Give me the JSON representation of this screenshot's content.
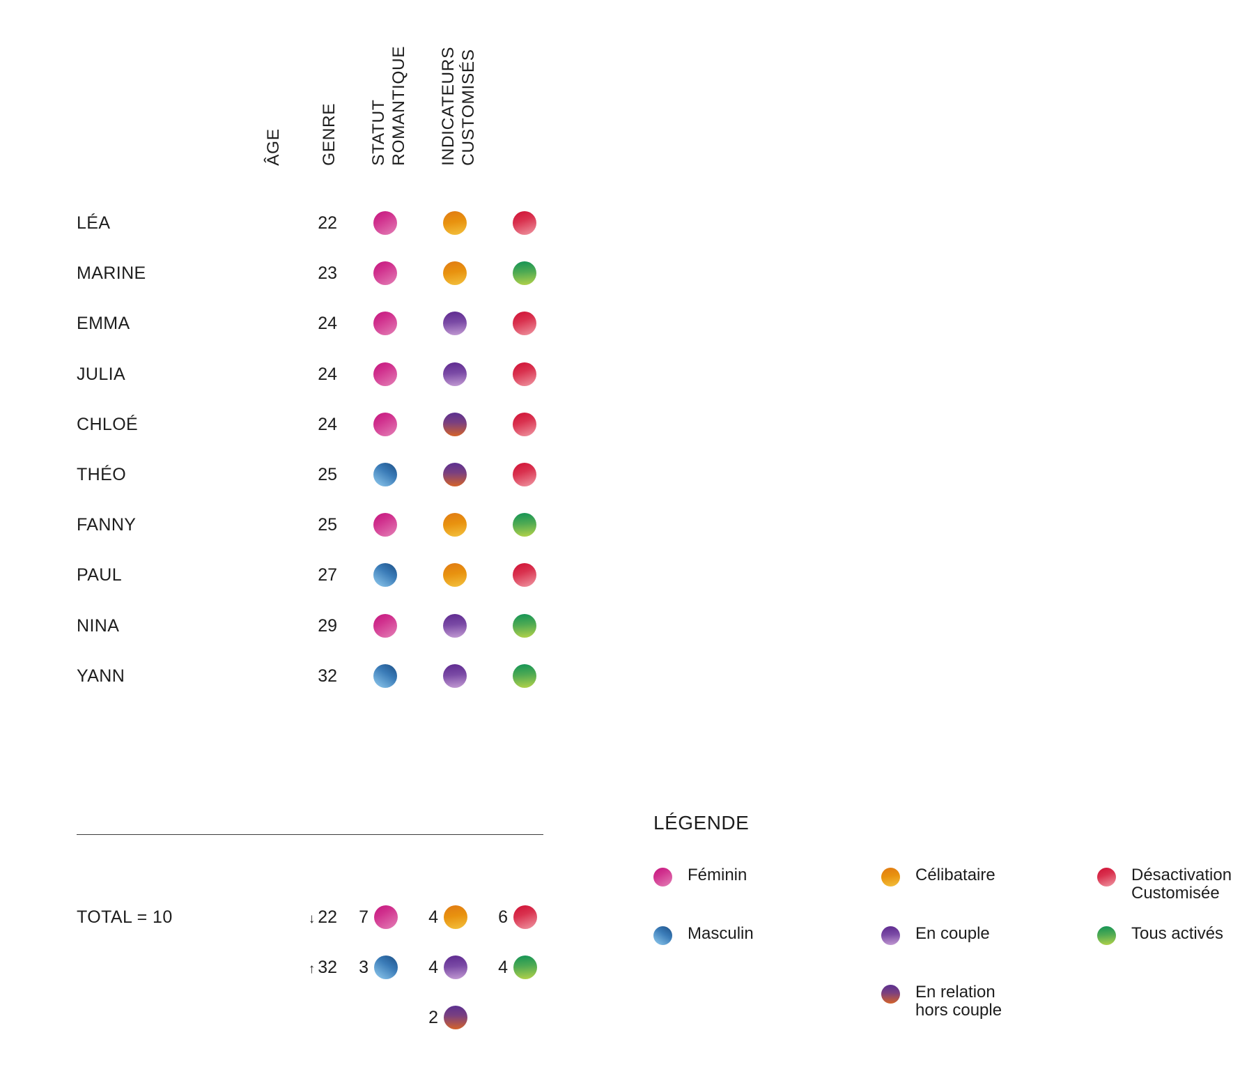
{
  "columns": [
    {
      "id": "age",
      "lines": [
        "ÂGE"
      ]
    },
    {
      "id": "genre",
      "lines": [
        "GENRE"
      ]
    },
    {
      "id": "statut",
      "lines": [
        "STATUT",
        "ROMANTIQUE"
      ]
    },
    {
      "id": "indic",
      "lines": [
        "INDICATEURS",
        "CUSTOMISÉS"
      ]
    }
  ],
  "rows": [
    {
      "name": "LÉA",
      "age": "22",
      "genre": "feminin",
      "statut": "celibataire",
      "indicateurs": "desactivation"
    },
    {
      "name": "MARINE",
      "age": "23",
      "genre": "feminin",
      "statut": "celibataire",
      "indicateurs": "tous-actives"
    },
    {
      "name": "EMMA",
      "age": "24",
      "genre": "feminin",
      "statut": "en-couple",
      "indicateurs": "desactivation"
    },
    {
      "name": "JULIA",
      "age": "24",
      "genre": "feminin",
      "statut": "en-couple",
      "indicateurs": "desactivation"
    },
    {
      "name": "CHLOÉ",
      "age": "24",
      "genre": "feminin",
      "statut": "en-relation",
      "indicateurs": "desactivation"
    },
    {
      "name": "THÉO",
      "age": "25",
      "genre": "masculin",
      "statut": "en-relation",
      "indicateurs": "desactivation"
    },
    {
      "name": "FANNY",
      "age": "25",
      "genre": "feminin",
      "statut": "celibataire",
      "indicateurs": "tous-actives"
    },
    {
      "name": "PAUL",
      "age": "27",
      "genre": "masculin",
      "statut": "celibataire",
      "indicateurs": "desactivation"
    },
    {
      "name": "NINA",
      "age": "29",
      "genre": "feminin",
      "statut": "en-couple",
      "indicateurs": "tous-actives"
    },
    {
      "name": "YANN",
      "age": "32",
      "genre": "masculin",
      "statut": "en-couple",
      "indicateurs": "tous-actives"
    }
  ],
  "totals": {
    "label": "TOTAL = 10",
    "age_min": {
      "arrow": "↓",
      "value": "22"
    },
    "age_max": {
      "arrow": "↑",
      "value": "32"
    },
    "genre": [
      {
        "count": "7",
        "swatch": "feminin"
      },
      {
        "count": "3",
        "swatch": "masculin"
      }
    ],
    "statut": [
      {
        "count": "4",
        "swatch": "celibataire"
      },
      {
        "count": "4",
        "swatch": "en-couple"
      },
      {
        "count": "2",
        "swatch": "en-relation"
      }
    ],
    "indicateurs": [
      {
        "count": "6",
        "swatch": "desactivation"
      },
      {
        "count": "4",
        "swatch": "tous-actives"
      }
    ]
  },
  "legend": {
    "title": "LÉGENDE",
    "items": [
      {
        "swatch": "feminin",
        "label": "Féminin",
        "col": 1,
        "row": 1
      },
      {
        "swatch": "masculin",
        "label": "Masculin",
        "col": 1,
        "row": 2
      },
      {
        "swatch": "celibataire",
        "label": "Célibataire",
        "col": 2,
        "row": 1
      },
      {
        "swatch": "en-couple",
        "label": "En couple",
        "col": 2,
        "row": 2
      },
      {
        "swatch": "en-relation",
        "label": "En relation\nhors couple",
        "col": 2,
        "row": 3
      },
      {
        "swatch": "desactivation",
        "label": "Désactivation\nCustomisée",
        "col": 3,
        "row": 1
      },
      {
        "swatch": "tous-actives",
        "label": "Tous activés",
        "col": 3,
        "row": 2
      }
    ]
  },
  "swatch_colors": {
    "feminin": {
      "from": "#c4157e",
      "to": "#e481b7"
    },
    "masculin": {
      "from": "#1c4f86",
      "to": "#93cdf0"
    },
    "celibataire": {
      "from": "#e07a14",
      "to": "#f3c23f"
    },
    "en-couple": {
      "from": "#5e2a8f",
      "to": "#c49cd4"
    },
    "en-relation": {
      "from": "#5c3090",
      "to": "#d4632a"
    },
    "desactivation": {
      "from": "#cf0f33",
      "to": "#f09aa5"
    },
    "tous-actives": {
      "from": "#139356",
      "to": "#b5d34a"
    }
  },
  "chart_data": {
    "type": "table",
    "title": "",
    "categories": [
      "LÉA",
      "MARINE",
      "EMMA",
      "JULIA",
      "CHLOÉ",
      "THÉO",
      "FANNY",
      "PAUL",
      "NINA",
      "YANN"
    ],
    "columns": [
      "ÂGE",
      "GENRE",
      "STATUT ROMANTIQUE",
      "INDICATEURS CUSTOMISÉS"
    ],
    "series": [
      {
        "name": "ÂGE",
        "values": [
          22,
          23,
          24,
          24,
          24,
          25,
          25,
          27,
          29,
          32
        ]
      },
      {
        "name": "GENRE",
        "values": [
          "Féminin",
          "Féminin",
          "Féminin",
          "Féminin",
          "Féminin",
          "Masculin",
          "Féminin",
          "Masculin",
          "Féminin",
          "Masculin"
        ]
      },
      {
        "name": "STATUT ROMANTIQUE",
        "values": [
          "Célibataire",
          "Célibataire",
          "En couple",
          "En couple",
          "En relation hors couple",
          "En relation hors couple",
          "Célibataire",
          "Célibataire",
          "En couple",
          "En couple"
        ]
      },
      {
        "name": "INDICATEURS CUSTOMISÉS",
        "values": [
          "Désactivation Customisée",
          "Tous activés",
          "Désactivation Customisée",
          "Désactivation Customisée",
          "Désactivation Customisée",
          "Désactivation Customisée",
          "Tous activés",
          "Désactivation Customisée",
          "Tous activés",
          "Tous activés"
        ]
      }
    ],
    "summary": {
      "total": 10,
      "age_min": 22,
      "age_max": 32,
      "genre_counts": {
        "Féminin": 7,
        "Masculin": 3
      },
      "statut_counts": {
        "Célibataire": 4,
        "En couple": 4,
        "En relation hors couple": 2
      },
      "indicateurs_counts": {
        "Désactivation Customisée": 6,
        "Tous activés": 4
      }
    }
  }
}
